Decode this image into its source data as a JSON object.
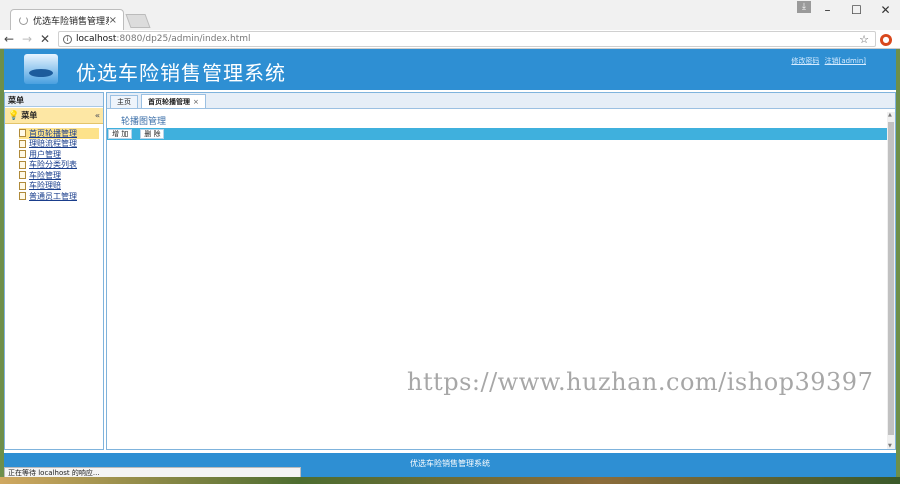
{
  "browser": {
    "tab_title": "优选车险销售管理系统",
    "tab_close": "×",
    "url_host": "localhost",
    "url_path": ":8080/dp25/admin/index.html",
    "status_text": "正在等待 localhost 的响应...",
    "window_buttons": [
      "–",
      "☐",
      "✕"
    ],
    "icons": {
      "back": "←",
      "forward": "→",
      "stop": "✕",
      "info": "i",
      "star": "☆",
      "download": "⤓",
      "ext": "●"
    }
  },
  "app": {
    "title": "优选车险销售管理系统",
    "header_links": [
      "修改密码",
      "注销[admin]"
    ],
    "footer_text": "优选车险销售管理系统",
    "accent": "#2e8fd3"
  },
  "sidebar": {
    "title": "菜单",
    "menu_title": "菜单",
    "collapse_icon": "«",
    "items": [
      {
        "label": "首页轮播管理"
      },
      {
        "label": "理赔流程管理"
      },
      {
        "label": "用户管理"
      },
      {
        "label": "车险分类列表"
      },
      {
        "label": "车险管理"
      },
      {
        "label": "车险理赔"
      },
      {
        "label": "普通员工管理"
      }
    ]
  },
  "main": {
    "tabs": [
      {
        "label": "主页"
      },
      {
        "label": "首页轮播管理",
        "close": "×"
      }
    ],
    "panel_title": "轮播图管理",
    "toolbar": {
      "add_label": "增 加",
      "delete_label": "删 除"
    },
    "watermark": "https://www.huzhan.com/ishop39397"
  }
}
